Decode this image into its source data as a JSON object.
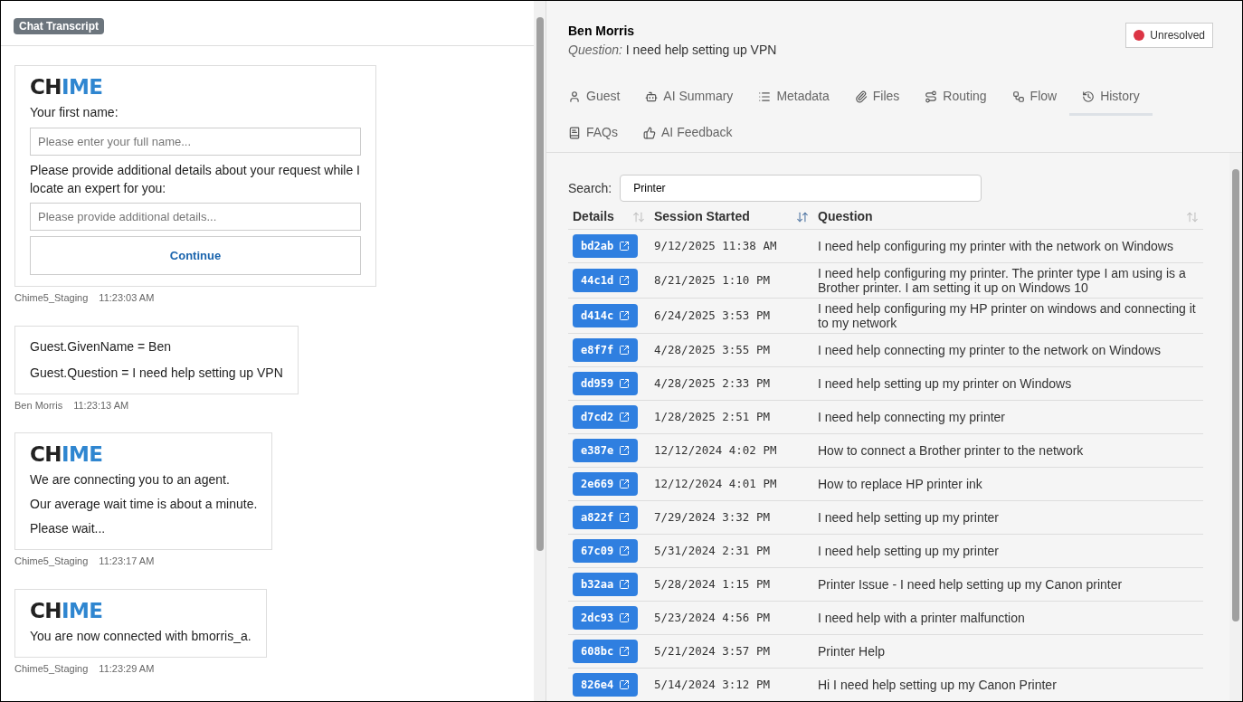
{
  "transcript": {
    "badge": "Chat Transcript",
    "messages": [
      {
        "kind": "form",
        "logo": {
          "dark": "CH",
          "accent": "IME"
        },
        "label": "Your first name:",
        "name_placeholder": "Please enter your full name...",
        "details_label": "Please provide additional details about your request while I locate an expert for you:",
        "details_placeholder": "Please provide additional details...",
        "button": "Continue",
        "sender": "Chime5_Staging",
        "time": "11:23:03 AM"
      },
      {
        "kind": "vars",
        "lines": [
          "Guest.GivenName = Ben",
          "Guest.Question = I need help setting up VPN"
        ],
        "sender": "Ben Morris",
        "time": "11:23:13 AM"
      },
      {
        "kind": "notice",
        "logo": {
          "dark": "CH",
          "accent": "IME"
        },
        "lines": [
          "We are connecting you to an agent.",
          "Our average wait time is about a minute.",
          "Please wait..."
        ],
        "sender": "Chime5_Staging",
        "time": "11:23:17 AM"
      },
      {
        "kind": "notice",
        "logo": {
          "dark": "CH",
          "accent": "IME"
        },
        "lines": [
          "You are now connected with bmorris_a."
        ],
        "sender": "Chime5_Staging",
        "time": "11:23:29 AM"
      }
    ]
  },
  "guest": {
    "name": "Ben Morris",
    "question_label": "Question:",
    "question": "I need help setting up VPN",
    "status": {
      "label": "Unresolved",
      "color": "#dc3545"
    }
  },
  "tabs": [
    {
      "label": "Guest",
      "selected": false
    },
    {
      "label": "AI Summary",
      "selected": false
    },
    {
      "label": "Metadata",
      "selected": false
    },
    {
      "label": "Files",
      "selected": false
    },
    {
      "label": "Routing",
      "selected": false
    },
    {
      "label": "Flow",
      "selected": false
    },
    {
      "label": "History",
      "selected": true
    },
    {
      "label": "FAQs",
      "selected": false
    },
    {
      "label": "AI Feedback",
      "selected": false
    }
  ],
  "search": {
    "label": "Search:",
    "value": "Printer"
  },
  "table": {
    "columns": [
      {
        "label": "Details",
        "sorted": false
      },
      {
        "label": "Session Started",
        "sorted": true
      },
      {
        "label": "Question",
        "sorted": false
      }
    ],
    "rows": [
      {
        "id": "bd2ab",
        "started": "9/12/2025 11:38 AM",
        "question": "I need help configuring my printer with the network on Windows"
      },
      {
        "id": "44c1d",
        "started": "8/21/2025 1:10 PM",
        "question": "I need help configuring my printer. The printer type I am using is a Brother printer. I am setting it up on Windows 10"
      },
      {
        "id": "d414c",
        "started": "6/24/2025 3:53 PM",
        "question": "I need help configuring my HP printer on windows and connecting it to my network"
      },
      {
        "id": "e8f7f",
        "started": "4/28/2025 3:55 PM",
        "question": "I need help connecting my printer to the network on Windows"
      },
      {
        "id": "dd959",
        "started": "4/28/2025 2:33 PM",
        "question": "I need help setting up my printer on Windows"
      },
      {
        "id": "d7cd2",
        "started": "1/28/2025 2:51 PM",
        "question": "I need help connecting my printer"
      },
      {
        "id": "e387e",
        "started": "12/12/2024 4:02 PM",
        "question": "How to connect a Brother printer to the network"
      },
      {
        "id": "2e669",
        "started": "12/12/2024 4:01 PM",
        "question": "How to replace HP printer ink"
      },
      {
        "id": "a822f",
        "started": "7/29/2024 3:32 PM",
        "question": "I need help setting up my printer"
      },
      {
        "id": "67c09",
        "started": "5/31/2024 2:31 PM",
        "question": "I need help setting up my printer"
      },
      {
        "id": "b32aa",
        "started": "5/28/2024 1:15 PM",
        "question": "Printer Issue - I need help setting up my Canon printer"
      },
      {
        "id": "2dc93",
        "started": "5/23/2024 4:56 PM",
        "question": "I need help with a printer malfunction"
      },
      {
        "id": "608bc",
        "started": "5/21/2024 3:57 PM",
        "question": "Printer Help"
      },
      {
        "id": "826e4",
        "started": "5/14/2024 3:12 PM",
        "question": "Hi I need help setting up my Canon Printer"
      }
    ]
  }
}
